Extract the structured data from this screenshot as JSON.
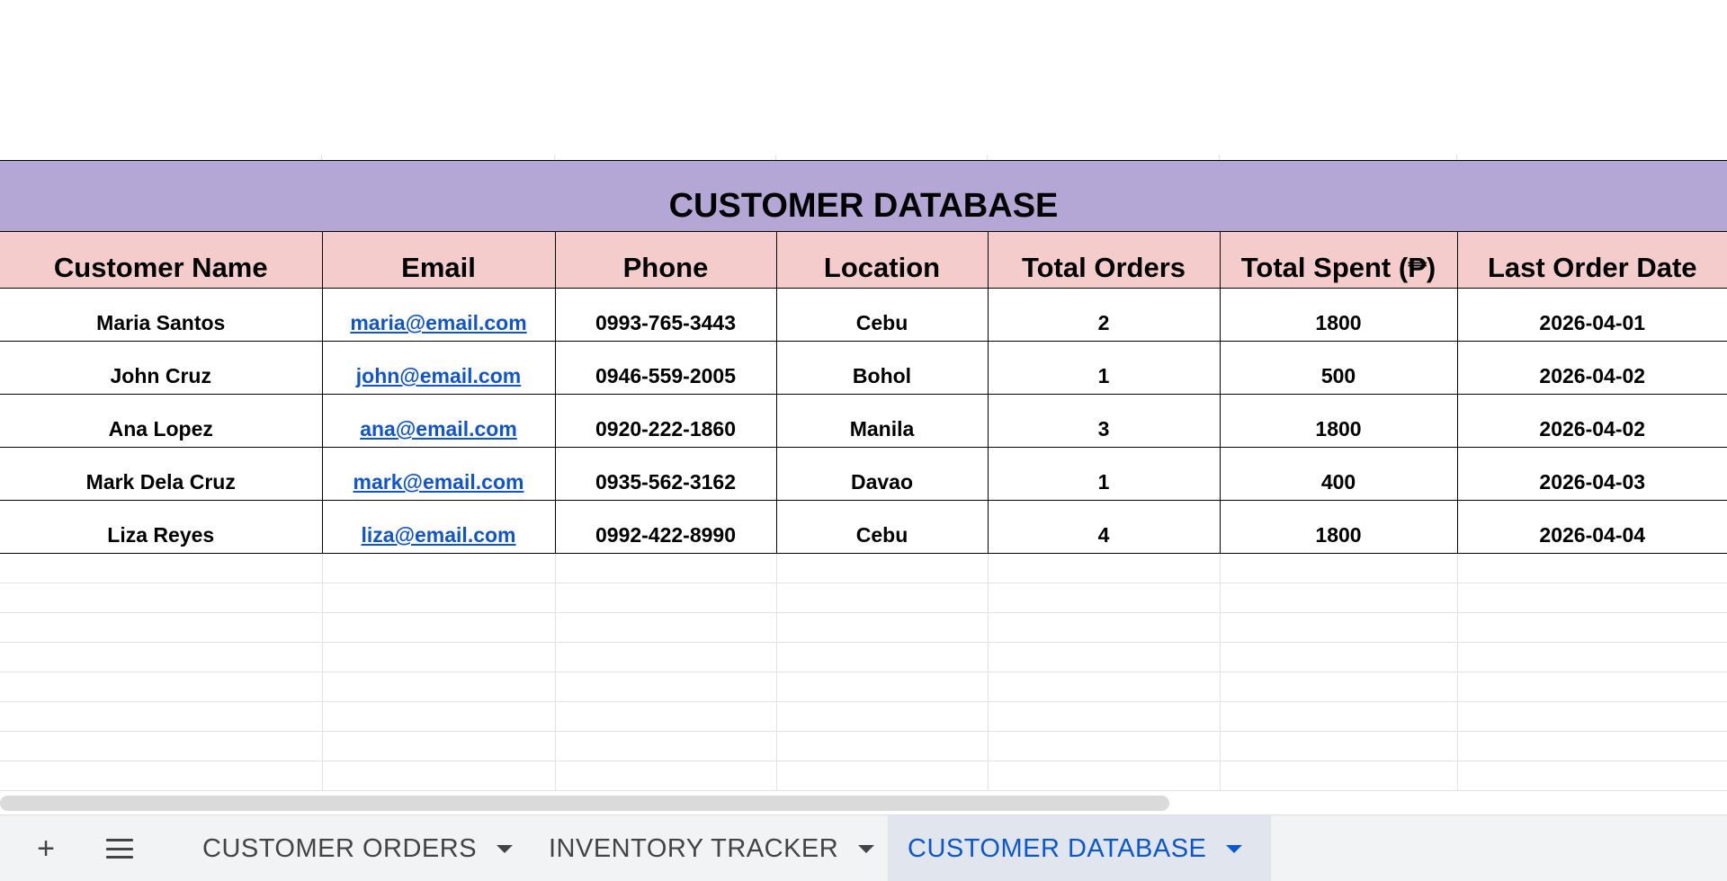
{
  "sheet": {
    "title": "CUSTOMER DATABASE",
    "headers": [
      "Customer Name",
      "Email",
      "Phone",
      "Location",
      "Total Orders",
      "Total Spent (₱)",
      "Last Order Date"
    ],
    "rows": [
      [
        "Maria Santos",
        "maria@email.com",
        "0993-765-3443",
        "Cebu",
        "2",
        "1800",
        "2026-04-01"
      ],
      [
        "John Cruz",
        "john@email.com",
        "0946-559-2005",
        "Bohol",
        "1",
        "500",
        "2026-04-02"
      ],
      [
        "Ana Lopez",
        "ana@email.com",
        "0920-222-1860",
        "Manila",
        "3",
        "1800",
        "2026-04-02"
      ],
      [
        "Mark Dela Cruz",
        "mark@email.com",
        "0935-562-3162",
        "Davao",
        "1",
        "400",
        "2026-04-03"
      ],
      [
        "Liza Reyes",
        "liza@email.com",
        "0992-422-8990",
        "Cebu",
        "4",
        "1800",
        "2026-04-04"
      ]
    ]
  },
  "tabs": {
    "add_icon": "plus-icon",
    "menu_icon": "menu-icon",
    "items": [
      {
        "label": "CUSTOMER ORDERS",
        "active": false
      },
      {
        "label": "INVENTORY TRACKER",
        "active": false
      },
      {
        "label": "CUSTOMER DATABASE",
        "active": true
      }
    ]
  },
  "colors": {
    "title_bg": "#b4a7d6",
    "header_bg": "#f4cccc",
    "link": "#1155cc",
    "active_tab": "#0b57d0"
  }
}
